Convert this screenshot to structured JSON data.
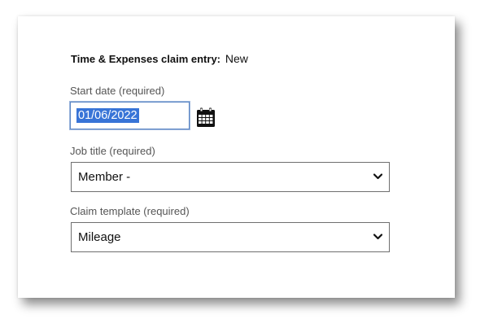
{
  "form": {
    "title_strong": "Time & Expenses claim entry:",
    "title_status": "New",
    "start_date": {
      "label": "Start date (required)",
      "value": "01/06/2022"
    },
    "job_title": {
      "label": "Job title (required)",
      "value": "Member -"
    },
    "claim_template": {
      "label": "Claim template (required)",
      "value": "Mileage"
    }
  },
  "icons": {
    "calendar": "calendar-icon",
    "chevron": "chevron-down-icon"
  },
  "colors": {
    "selection": "#3874d7",
    "focus_border": "#5b86c5"
  }
}
